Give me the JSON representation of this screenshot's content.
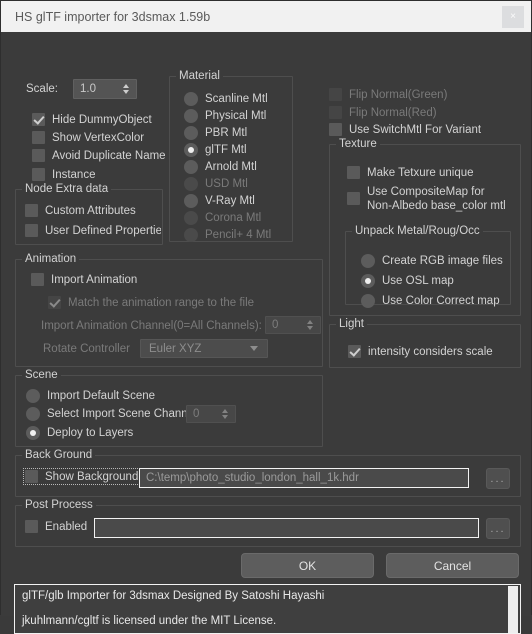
{
  "window": {
    "title": "HS glTF importer for 3dsmax 1.59b",
    "close_icon": "close-icon",
    "close_label": "×"
  },
  "scale": {
    "label": "Scale:",
    "value": "1.0"
  },
  "options": [
    {
      "label": "Hide DummyObject",
      "checked": true,
      "enabled": true
    },
    {
      "label": "Show VertexColor",
      "checked": false,
      "enabled": true
    },
    {
      "label": "Avoid Duplicate Name",
      "checked": false,
      "enabled": true
    },
    {
      "label": "Instance",
      "checked": false,
      "enabled": true
    }
  ],
  "node_extra": {
    "caption": "Node Extra data",
    "items": [
      {
        "label": "Custom Attributes",
        "checked": false,
        "enabled": true
      },
      {
        "label": "User Defined Properties",
        "checked": false,
        "enabled": true
      }
    ]
  },
  "material": {
    "caption": "Material",
    "items": [
      {
        "label": "Scanline Mtl",
        "selected": false,
        "enabled": true
      },
      {
        "label": "Physical Mtl",
        "selected": false,
        "enabled": true
      },
      {
        "label": "PBR Mtl",
        "selected": false,
        "enabled": true
      },
      {
        "label": "glTF Mtl",
        "selected": true,
        "enabled": true
      },
      {
        "label": "Arnold Mtl",
        "selected": false,
        "enabled": true
      },
      {
        "label": "USD Mtl",
        "selected": false,
        "enabled": false
      },
      {
        "label": "V-Ray Mtl",
        "selected": false,
        "enabled": true
      },
      {
        "label": "Corona Mtl",
        "selected": false,
        "enabled": false
      },
      {
        "label": "Pencil+ 4 Mtl",
        "selected": false,
        "enabled": false
      }
    ]
  },
  "flags": [
    {
      "label": "Flip Normal(Green)",
      "checked": false,
      "enabled": false
    },
    {
      "label": "Flip Normal(Red)",
      "checked": false,
      "enabled": false
    },
    {
      "label": "Use SwitchMtl For Variant",
      "checked": false,
      "enabled": true
    }
  ],
  "texture": {
    "caption": "Texture",
    "make_unique": {
      "label": "Make Tetxure unique",
      "checked": false,
      "enabled": true
    },
    "composite": {
      "line1": "Use CompositeMap for",
      "line2": "Non-Albedo base_color mtl",
      "checked": false,
      "enabled": true
    },
    "unpack": {
      "caption": "Unpack Metal/Roug/Occ",
      "items": [
        {
          "label": "Create RGB image files",
          "selected": false,
          "enabled": true
        },
        {
          "label": "Use OSL map",
          "selected": true,
          "enabled": true
        },
        {
          "label": "Use Color Correct map",
          "selected": false,
          "enabled": true
        }
      ]
    }
  },
  "light": {
    "caption": "Light",
    "item": {
      "label": "intensity considers scale",
      "checked": true,
      "enabled": true
    }
  },
  "animation": {
    "caption": "Animation",
    "import": {
      "label": "Import Animation",
      "checked": false,
      "enabled": true
    },
    "match": {
      "label": "Match the animation range to the file",
      "checked": true,
      "enabled": false
    },
    "channel": {
      "label": "Import Animation Channel(0=All Channels):",
      "value": "0",
      "enabled": false
    },
    "rotate": {
      "label": "Rotate Controller",
      "value": "Euler XYZ",
      "enabled": false
    }
  },
  "scene": {
    "caption": "Scene",
    "items": [
      {
        "label": "Import Default Scene",
        "selected": false,
        "enabled": true
      },
      {
        "label": "Select Import Scene Channel",
        "selected": false,
        "enabled": true
      },
      {
        "label": "Deploy to Layers",
        "selected": true,
        "enabled": true
      }
    ],
    "channel_value": "0"
  },
  "background": {
    "caption": "Back Ground",
    "show": {
      "label": "Show Background",
      "checked": false,
      "enabled": true
    },
    "path": "C:\\temp\\photo_studio_london_hall_1k.hdr",
    "browse_label": "..."
  },
  "post_process": {
    "caption": "Post Process",
    "enabled_cb": {
      "label": "Enabled",
      "checked": false,
      "enabled": true
    },
    "path": "",
    "browse_label": "..."
  },
  "buttons": {
    "ok": "OK",
    "cancel": "Cancel"
  },
  "console": {
    "line1": "glTF/glb Importer for 3dsmax Designed By Satoshi Hayashi",
    "line2": "",
    "line3": "jkuhlmann/cgltf is licensed under the MIT License."
  }
}
